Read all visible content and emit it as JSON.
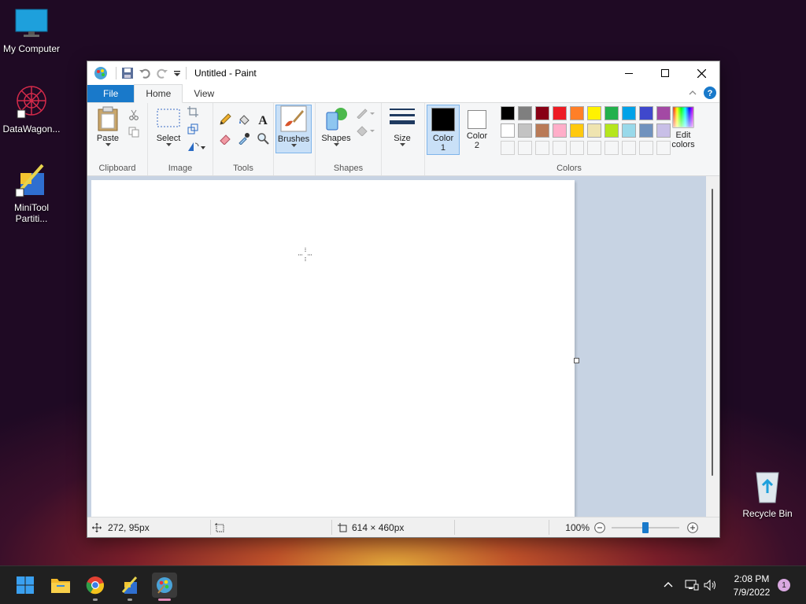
{
  "desktop": {
    "icons": [
      {
        "label": "My Computer"
      },
      {
        "label": "DataWagon..."
      },
      {
        "label": "MiniTool Partiti..."
      },
      {
        "label": "Recycle Bin"
      }
    ]
  },
  "window": {
    "title": "Untitled - Paint",
    "tabs": {
      "file": "File",
      "home": "Home",
      "view": "View"
    },
    "ribbon": {
      "clipboard": {
        "group": "Clipboard",
        "paste": "Paste"
      },
      "image": {
        "group": "Image",
        "select": "Select"
      },
      "tools": {
        "group": "Tools"
      },
      "brushes": {
        "label": "Brushes"
      },
      "shapes": {
        "group": "Shapes",
        "label": "Shapes"
      },
      "size": {
        "label": "Size"
      },
      "colors": {
        "group": "Colors",
        "color1": "Color\n1",
        "color2": "Color\n2",
        "color1_value": "#000000",
        "color2_value": "#ffffff",
        "edit": "Edit colors",
        "palette_row1": [
          "#000000",
          "#7f7f7f",
          "#880015",
          "#ed1c24",
          "#ff7f27",
          "#fff200",
          "#22b14c",
          "#00a2e8",
          "#3f48cc",
          "#a349a4"
        ],
        "palette_row2": [
          "#ffffff",
          "#c3c3c3",
          "#b97a57",
          "#ffaec9",
          "#ffc90e",
          "#efe4b0",
          "#b5e61d",
          "#99d9ea",
          "#7092be",
          "#c8bfe7"
        ]
      }
    },
    "status": {
      "cursor_pos": "272, 95px",
      "image_size": "614 × 460px",
      "zoom": "100%",
      "zoom_slider_value": 0.5
    }
  },
  "taskbar": {
    "time": "2:08 PM",
    "date": "7/9/2022",
    "notifications": "1"
  },
  "colors": {
    "accent": "#1979ca",
    "canvas_bg": "#c7d3e3"
  }
}
